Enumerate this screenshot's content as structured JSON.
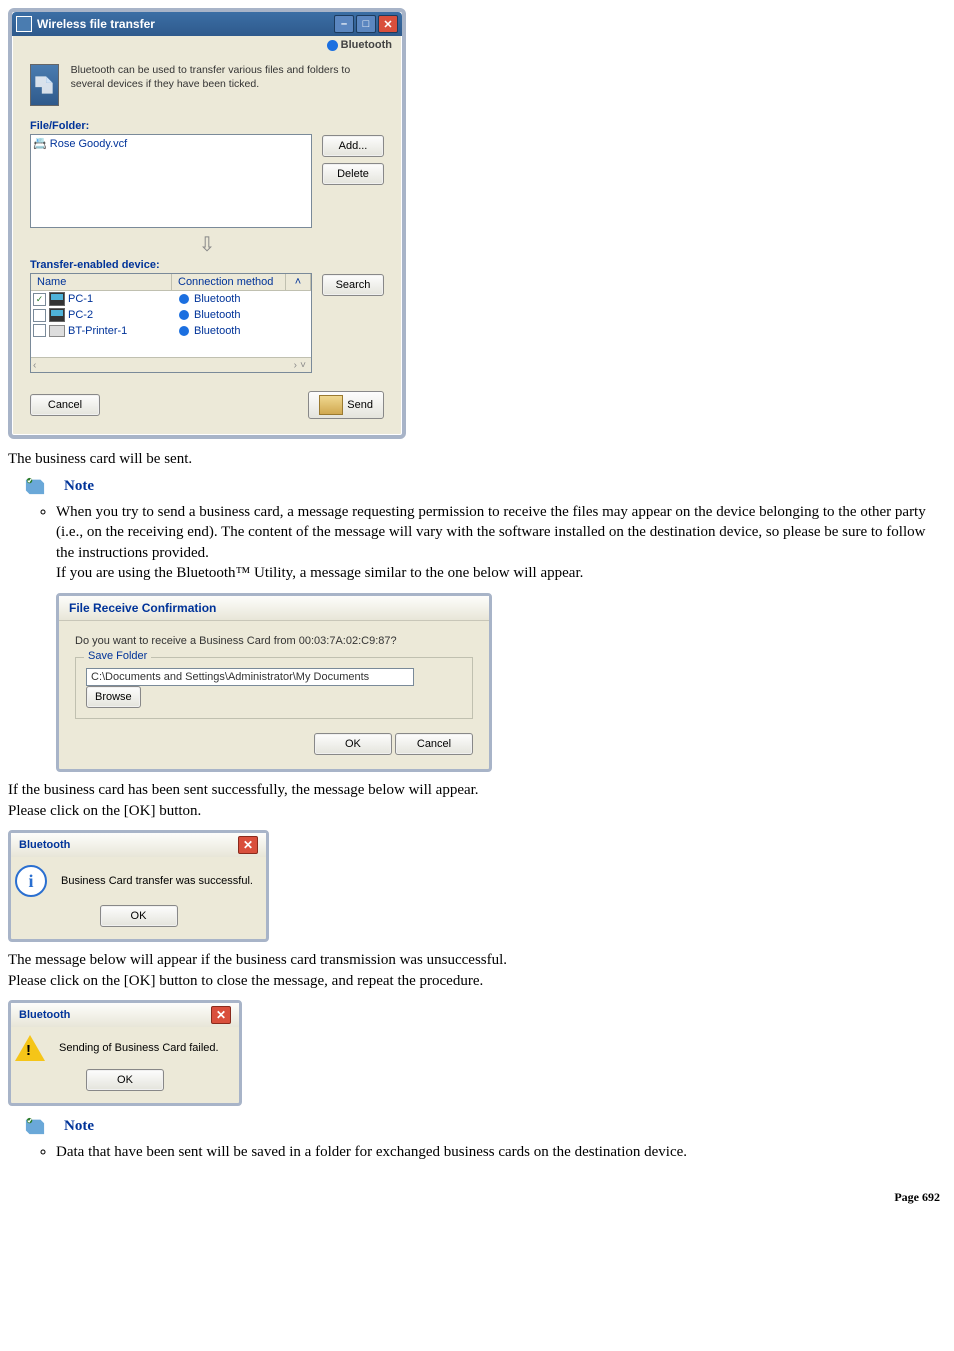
{
  "win": {
    "title": "Wireless file transfer",
    "brand": "Bluetooth",
    "intro": "Bluetooth can be used to transfer various files and folders to several devices if they have been ticked.",
    "fileFolderLabel": "File/Folder:",
    "fileItem": "Rose Goody.vcf",
    "addBtn": "Add...",
    "deleteBtn": "Delete",
    "transferLabel": "Transfer-enabled device:",
    "hdrName": "Name",
    "hdrConn": "Connection method",
    "devices": [
      {
        "name": "PC-1",
        "conn": "Bluetooth",
        "checked": true,
        "type": "pc"
      },
      {
        "name": "PC-2",
        "conn": "Bluetooth",
        "checked": false,
        "type": "pc"
      },
      {
        "name": "BT-Printer-1",
        "conn": "Bluetooth",
        "checked": false,
        "type": "printer"
      }
    ],
    "searchBtn": "Search",
    "cancelBtn": "Cancel",
    "sendBtn": "Send"
  },
  "txt": {
    "afterWin": "The business card will be sent.",
    "note1": "When you try to send a business card, a message requesting permission to receive the files may appear on the device belonging to the other party (i.e., on the receiving end). The content of the message will vary with the software installed on the destination device, so please be sure to follow the instructions provided.",
    "note1b_a": "If you are using the Bluetooth",
    "note1b_b": " Utility, a message similar to the one below will appear.",
    "tm": "™",
    "noteLabel": "Note",
    "afterConfirm1": "If the business card has been sent successfully, the message below will appear.",
    "afterConfirm2": "Please click on the [OK] button.",
    "afterSuccess1": "The message below will appear if the business card transmission was unsuccessful.",
    "afterSuccess2": "Please click on the [OK] button to close the message, and repeat the procedure.",
    "note2": "Data that have been sent will be saved in a folder for exchanged business cards on the destination device."
  },
  "confirm": {
    "title": "File Receive Confirmation",
    "q": "Do you want to receive a Business Card from 00:03:7A:02:C9:87?",
    "saveFolder": "Save Folder",
    "path": "C:\\Documents and Settings\\Administrator\\My Documents",
    "browse": "Browse",
    "ok": "OK",
    "cancel": "Cancel"
  },
  "msg": {
    "title": "Bluetooth",
    "success": "Business Card transfer was successful.",
    "fail": "Sending of Business Card failed.",
    "ok": "OK"
  },
  "page": "Page 692"
}
